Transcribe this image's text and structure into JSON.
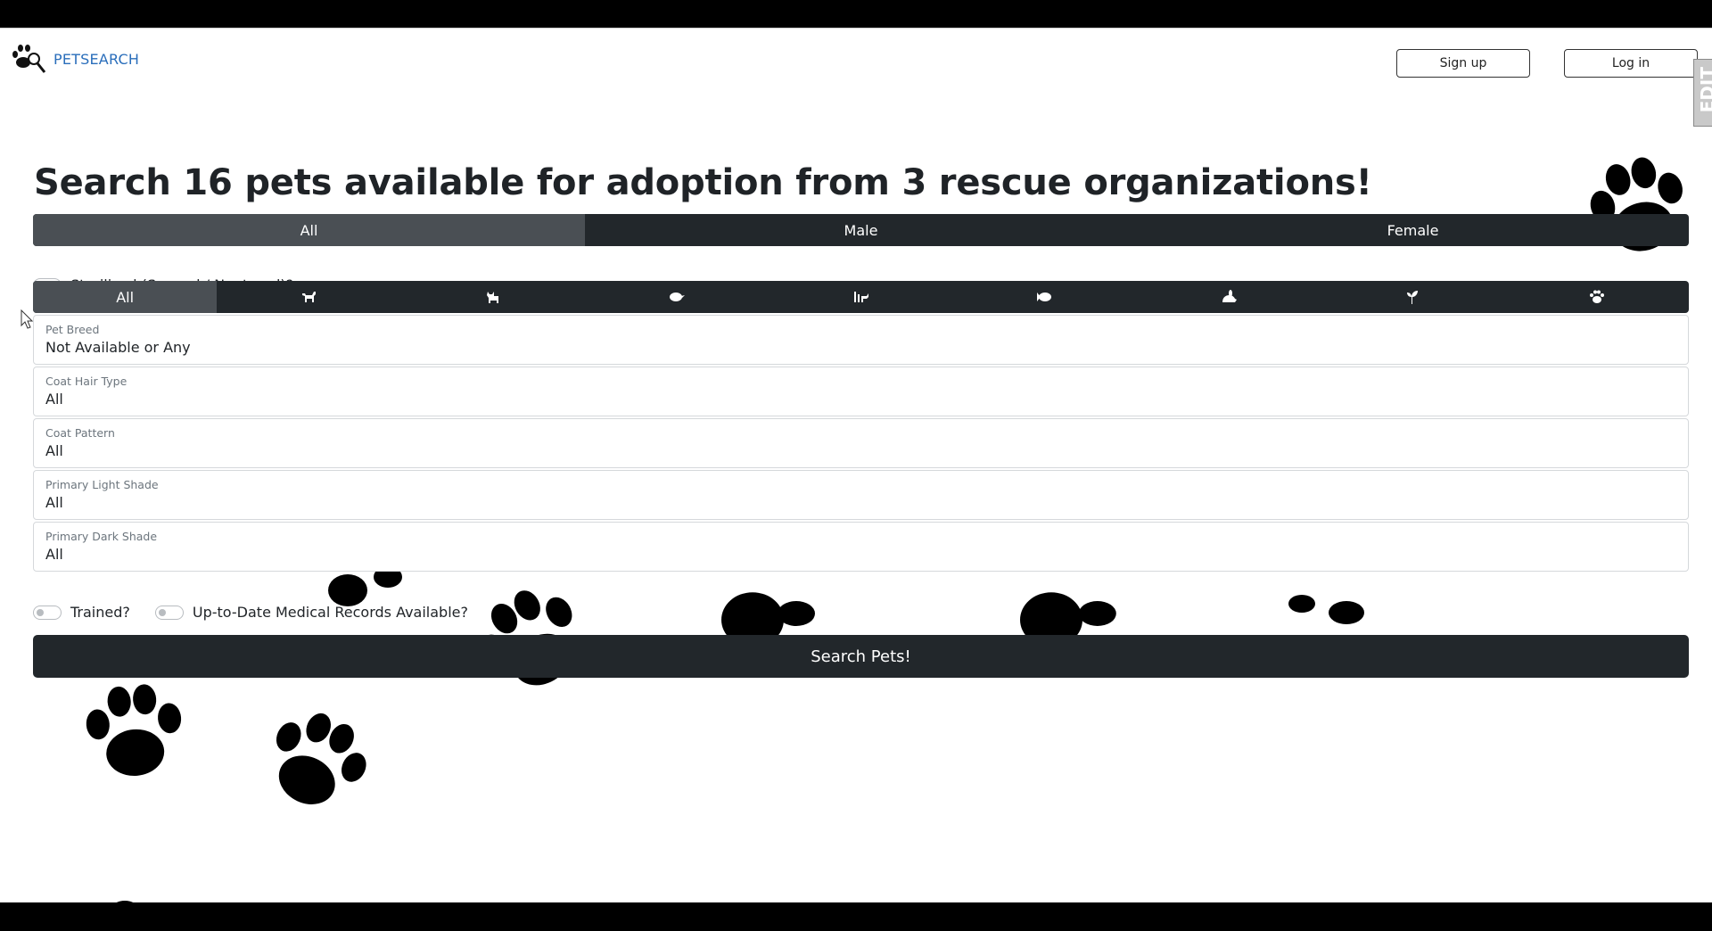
{
  "brand": {
    "name": "PETSEARCH",
    "logo_icon": "paw-magnifier-icon"
  },
  "header": {
    "signup_label": "Sign up",
    "login_label": "Log in"
  },
  "headline": "Search 16 pets available for adoption from 3 rescue organizations!",
  "sex_filter": {
    "options": [
      "All",
      "Male",
      "Female"
    ],
    "selected": "All"
  },
  "sterilized_label": "Sterilized (Spayed / Neutered)?",
  "type_filter": {
    "selected": "All",
    "options": [
      {
        "label": "All",
        "icon": null
      },
      {
        "label": "",
        "icon": "dog-icon"
      },
      {
        "label": "",
        "icon": "cat-icon"
      },
      {
        "label": "",
        "icon": "bird-icon"
      },
      {
        "label": "",
        "icon": "horse-icon"
      },
      {
        "label": "",
        "icon": "fish-icon"
      },
      {
        "label": "",
        "icon": "rabbit-icon"
      },
      {
        "label": "",
        "icon": "plant-icon"
      },
      {
        "label": "",
        "icon": "paw-icon"
      }
    ]
  },
  "fields": [
    {
      "label": "Pet Breed",
      "value": "Not Available or Any"
    },
    {
      "label": "Coat Hair Type",
      "value": "All"
    },
    {
      "label": "Coat Pattern",
      "value": "All"
    },
    {
      "label": "Primary Light Shade",
      "value": "All"
    },
    {
      "label": "Primary Dark Shade",
      "value": "All"
    }
  ],
  "trained_label": "Trained?",
  "medical_label": "Up-to-Date Medical Records Available?",
  "search_button_label": "Search Pets!",
  "side_tab_text": "EDIT",
  "colors": {
    "dark": "#22272b",
    "active": "#4a4f54",
    "brand": "#2a6ebb"
  }
}
